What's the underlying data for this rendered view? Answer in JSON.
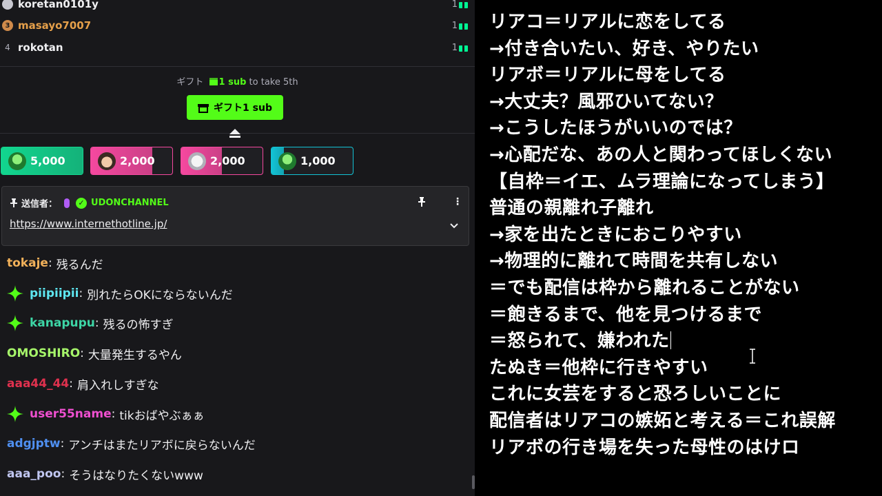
{
  "leaderboard": [
    {
      "rank": "",
      "name": "koretan0101y",
      "count": "1",
      "name_color": "#efeff1",
      "medal": "silver"
    },
    {
      "rank": "3",
      "name": "masayo7007",
      "count": "1",
      "name_color": "#e6a04a",
      "medal": "bronze"
    },
    {
      "rank": "4",
      "name": "rokotan",
      "count": "1",
      "name_color": "#efeff1",
      "medal": "none"
    }
  ],
  "gift_info": {
    "prefix": "ギフト",
    "highlight": "1 sub",
    "suffix": "to take 5th"
  },
  "gift_button": {
    "label": "ギフト1 sub"
  },
  "top_cards": [
    {
      "amount": "5,000",
      "color": "#12d68f",
      "fill_pct": 100,
      "avatar": "green-avatar"
    },
    {
      "amount": "2,000",
      "color": "#f5489f",
      "fill_pct": 75,
      "avatar": "face-avatar"
    },
    {
      "amount": "2,000",
      "color": "#f5489f",
      "fill_pct": 50,
      "avatar": "white-avatar"
    },
    {
      "amount": "1,000",
      "color": "#12c4d6",
      "fill_pct": 15,
      "avatar": "green-avatar"
    }
  ],
  "pinned": {
    "sender_label": "送信者：",
    "sender_name": "UDONCHANNEL",
    "link": "https://www.internethotline.jp/"
  },
  "chat": [
    {
      "user": "tokaje",
      "color": "#f2b15a",
      "badge": false,
      "text": "残るんだ"
    },
    {
      "user": "piipiipii",
      "color": "#5ee6f0",
      "badge": true,
      "text": "別れたらOKにならないんだ"
    },
    {
      "user": "kanapupu",
      "color": "#3dd6a6",
      "badge": true,
      "text": "残るの怖すぎ"
    },
    {
      "user": "OMOSHIRO",
      "color": "#a6f56a",
      "badge": false,
      "text": "大量発生するやん"
    },
    {
      "user": "aaa44_44",
      "color": "#e0314e",
      "badge": false,
      "text": "肩入れしすぎな"
    },
    {
      "user": "user55name",
      "color": "#ef4fd0",
      "badge": true,
      "text": "tikおばやぶぁぁ"
    },
    {
      "user": "adgjptw",
      "color": "#4f8ff0",
      "badge": false,
      "text": "アンチはまたリアボに戻らないんだ"
    },
    {
      "user": "aaa_poo",
      "color": "#c0c6f0",
      "badge": false,
      "text": "そうはなりたくないwww"
    }
  ],
  "notes": [
    "リアコ＝リアルに恋をしてる",
    "→付き合いたい、好き、やりたい",
    "リアボ＝リアルに母をしてる",
    "→大丈夫？風邪ひいてない？",
    "→こうしたほうがいいのでは？",
    "→心配だな、あの人と関わってほしくない",
    "【自枠＝イエ、ムラ理論になってしまう】",
    "普通の親離れ子離れ",
    "→家を出たときにおこりやすい",
    "→物理的に離れて時間を共有しない",
    "＝でも配信は枠から離れることがない",
    "＝飽きるまで、他を見つけるまで",
    "＝怒られて、嫌われた",
    "たぬき＝他枠に行きやすい",
    "これに女芸をすると恐ろしいことに",
    "配信者はリアコの嫉妬と考える＝これ誤解",
    "リアボの行き場を失った母性のはけロ"
  ]
}
